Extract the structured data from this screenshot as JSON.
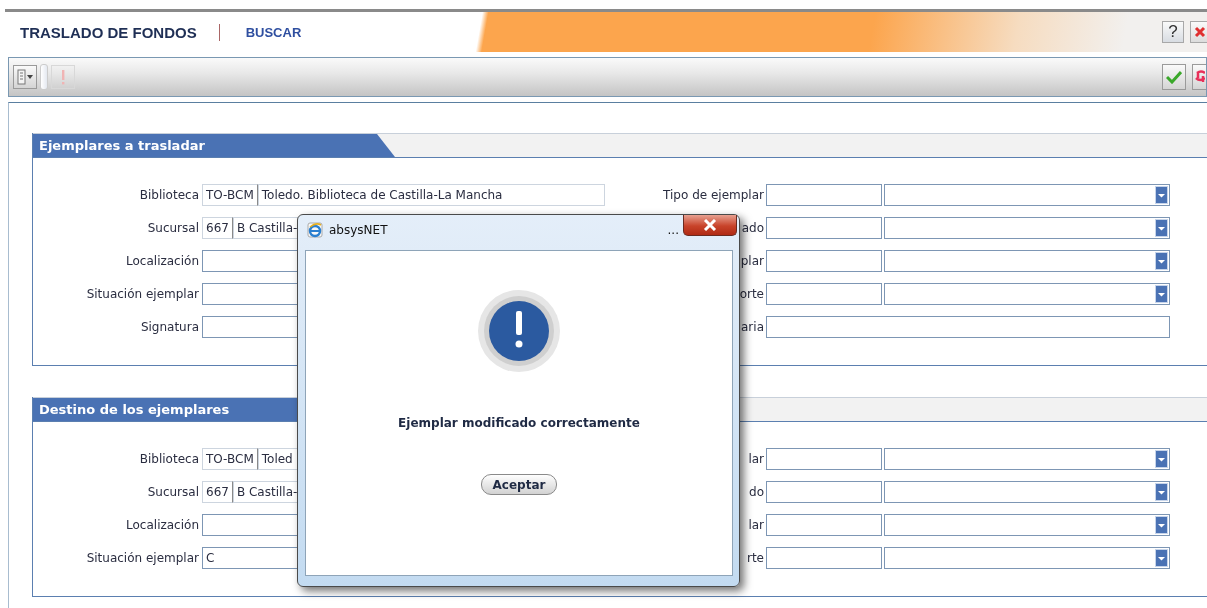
{
  "header": {
    "title": "TRASLADO DE FONDOS",
    "link": "BUSCAR",
    "help": "?"
  },
  "toolbar": {
    "left": [
      {
        "kind": "menu",
        "disabled": false
      },
      {
        "kind": "grip"
      },
      {
        "kind": "alert",
        "disabled": true
      }
    ],
    "right": [
      {
        "kind": "confirm"
      },
      {
        "kind": "cancel"
      }
    ]
  },
  "sections": [
    {
      "title": "Ejemplares a trasladar",
      "left_fields": [
        {
          "label": "Biblioteca",
          "kind": "split",
          "code": "TO-BCM",
          "value": "Toledo. Biblioteca de Castilla-La Mancha"
        },
        {
          "label": "Sucursal",
          "kind": "split",
          "code": "667",
          "value": "B Castilla-"
        },
        {
          "label": "Localización",
          "kind": "text"
        },
        {
          "label": "Situación ejemplar",
          "kind": "text"
        },
        {
          "label": "Signatura",
          "kind": "text"
        }
      ],
      "right_fields": [
        {
          "label": "Tipo de ejemplar",
          "kind": "select"
        },
        {
          "label": "ado",
          "kind": "select"
        },
        {
          "label": "plar",
          "kind": "select"
        },
        {
          "label": "orte",
          "kind": "select"
        },
        {
          "label": "aria",
          "kind": "text"
        }
      ]
    },
    {
      "title": "Destino de los ejemplares",
      "left_fields": [
        {
          "label": "Biblioteca",
          "kind": "split",
          "code": "TO-BCM",
          "value": "Toled"
        },
        {
          "label": "Sucursal",
          "kind": "split",
          "code": "667",
          "value": "B Castilla-"
        },
        {
          "label": "Localización",
          "kind": "text"
        },
        {
          "label": "Situación ejemplar",
          "kind": "text",
          "value": "C"
        }
      ],
      "right_fields": [
        {
          "label": "lar",
          "kind": "select"
        },
        {
          "label": "do",
          "kind": "select"
        },
        {
          "label": "lar",
          "kind": "select"
        },
        {
          "label": "rte",
          "kind": "select"
        }
      ]
    }
  ],
  "dialog": {
    "title": "absysNET",
    "title_ellipsis": "...",
    "message": "Ejemplar modificado correctamente",
    "button": "Aceptar"
  }
}
